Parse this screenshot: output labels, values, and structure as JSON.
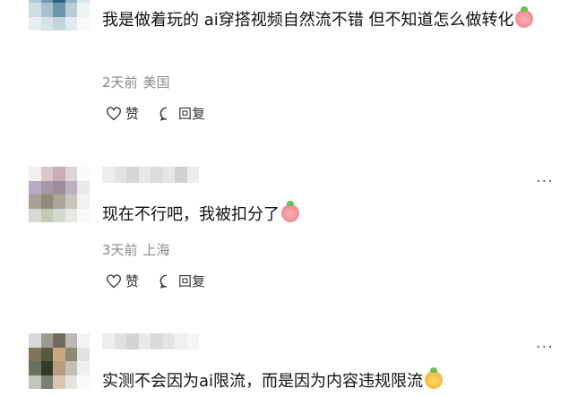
{
  "comments": [
    {
      "text": "我是做着玩的 ai穿搭视频自然流不错 但不知道怎么做转化",
      "time": "2天前",
      "location": "美国",
      "like_label": "赞",
      "reply_label": "回复",
      "emoji": "crying-face-emoji"
    },
    {
      "text": "现在不行吧，我被扣分了",
      "time": "3天前",
      "location": "上海",
      "like_label": "赞",
      "reply_label": "回复",
      "emoji": "crying-face-emoji",
      "more": "···"
    },
    {
      "text": "实测不会因为ai限流，而是因为内容违规限流",
      "more": "···",
      "emoji": "smiling-face-emoji"
    }
  ],
  "colors": {
    "meta_text": "#8a8a8a",
    "body_text": "#111111"
  }
}
